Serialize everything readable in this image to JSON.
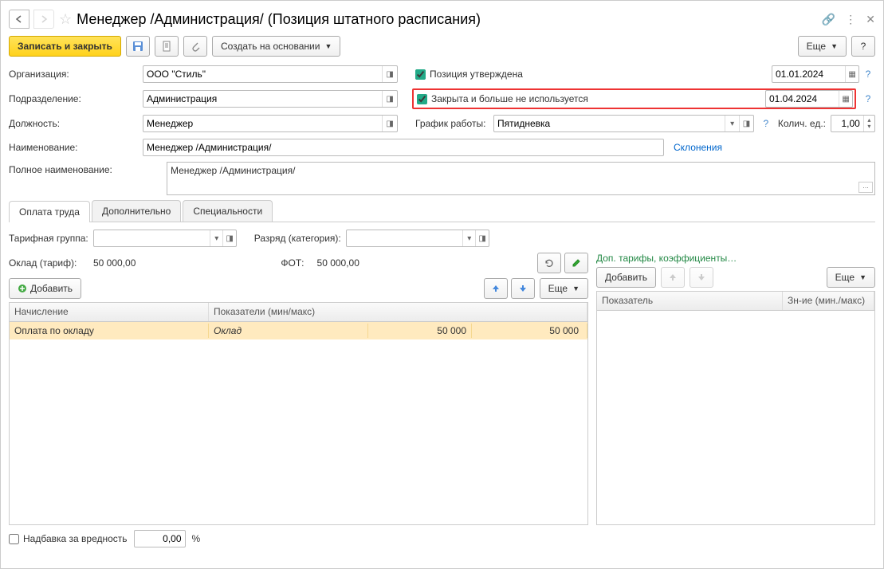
{
  "title": "Менеджер /Администрация/ (Позиция штатного расписания)",
  "toolbar": {
    "save_close": "Записать и закрыть",
    "create_based": "Создать на основании",
    "more": "Еще"
  },
  "labels": {
    "organization": "Организация:",
    "subdivision": "Подразделение:",
    "position": "Должность:",
    "name": "Наименование:",
    "full_name": "Полное наименование:",
    "schedule": "График работы:",
    "units": "Колич. ед.:",
    "tariff_group": "Тарифная группа:",
    "grade": "Разряд (категория):",
    "salary": "Оклад (тариф):",
    "fot": "ФОТ:",
    "add": "Добавить",
    "more": "Еще",
    "harm_bonus": "Надбавка за вредность",
    "percent": "%",
    "declensions": "Склонения",
    "additional_tariffs": "Доп. тарифы, коэффициенты…"
  },
  "fields": {
    "organization": "ООО \"Стиль\"",
    "subdivision": "Администрация",
    "position": "Менеджер",
    "name": "Менеджер /Администрация/",
    "full_name": "Менеджер /Администрация/",
    "schedule": "Пятидневка",
    "units": "1,00",
    "salary": "50 000,00",
    "fot": "50 000,00",
    "harm_bonus": "0,00"
  },
  "checkboxes": {
    "approved": {
      "label": "Позиция утверждена",
      "date": "01.01.2024"
    },
    "closed": {
      "label": "Закрыта и больше не используется",
      "date": "01.04.2024"
    }
  },
  "tabs": {
    "pay": "Оплата труда",
    "additional": "Дополнительно",
    "specialties": "Специальности"
  },
  "table_main": {
    "headers": {
      "accrual": "Начисление",
      "indicators": "Показатели (мин/макс)"
    },
    "rows": [
      {
        "accrual": "Оплата по окладу",
        "indicator": "Оклад",
        "min": "50 000",
        "max": "50 000"
      }
    ]
  },
  "table_side": {
    "headers": {
      "indicator": "Показатель",
      "value": "Зн-ие (мин./макс)"
    }
  }
}
